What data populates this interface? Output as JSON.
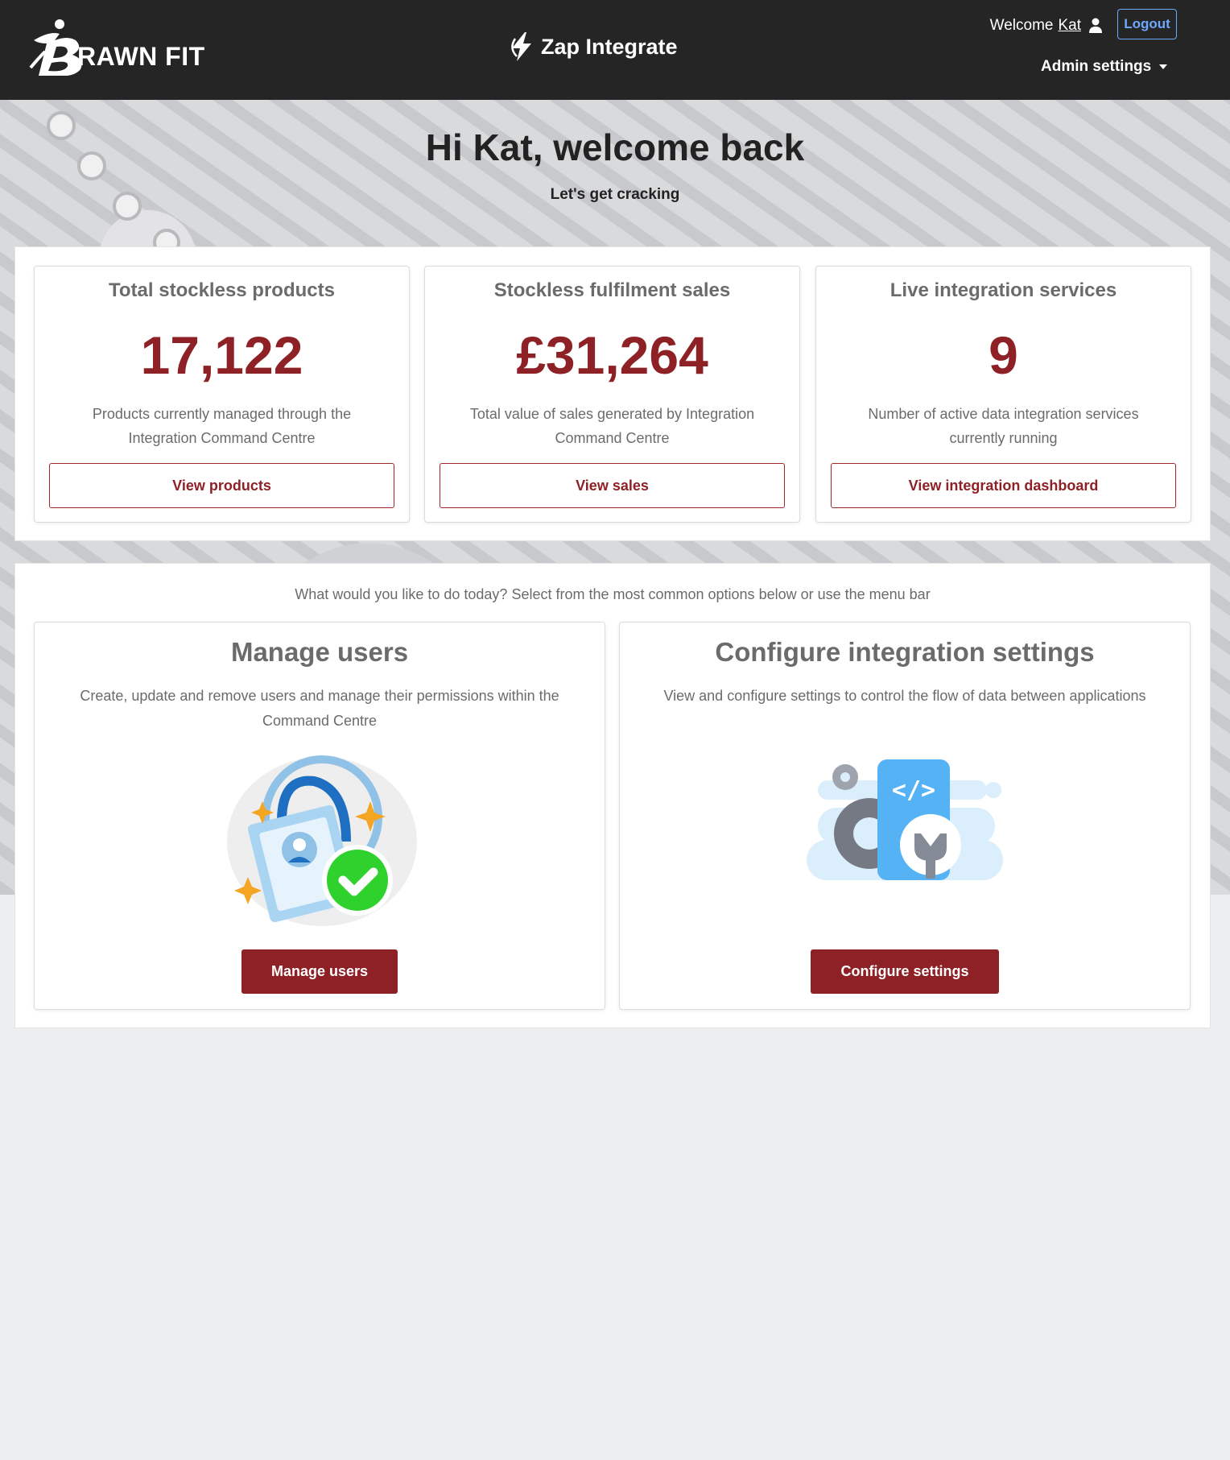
{
  "header": {
    "brand_name": "RAWN FIT",
    "product_name": "Zap Integrate",
    "welcome_text": "Welcome",
    "user_name": "Kat",
    "logout_label": "Logout",
    "admin_menu_label": "Admin settings"
  },
  "hero": {
    "title": "Hi Kat, welcome back",
    "subtitle": "Let's get cracking"
  },
  "stats": [
    {
      "title": "Total stockless products",
      "value": "17,122",
      "description": "Products currently managed through the Integration Command Centre",
      "button_label": "View products"
    },
    {
      "title": "Stockless fulfilment sales",
      "value": "£31,264",
      "description": "Total value of sales generated by Integration Command Centre",
      "button_label": "View sales"
    },
    {
      "title": "Live integration services",
      "value": "9",
      "description": "Number of active data integration services currently running",
      "button_label": "View integration dashboard"
    }
  ],
  "actions": {
    "intro": "What would you like to do today? Select from the most common options below or use the menu bar",
    "cards": [
      {
        "title": "Manage users",
        "description": "Create, update and remove users and manage their permissions within the Command Centre",
        "illustration": "user-id-badge-check-icon",
        "button_label": "Manage users"
      },
      {
        "title": "Configure integration settings",
        "description": "View and configure settings to control the flow of data between applications",
        "illustration": "code-gear-wrench-icon",
        "button_label": "Configure settings"
      }
    ]
  },
  "colors": {
    "header_bg": "#252525",
    "accent": "#8e2126",
    "logout_outline": "#6ea8fe",
    "page_bg": "#eceeef",
    "muted_text": "#6b6b6b"
  }
}
